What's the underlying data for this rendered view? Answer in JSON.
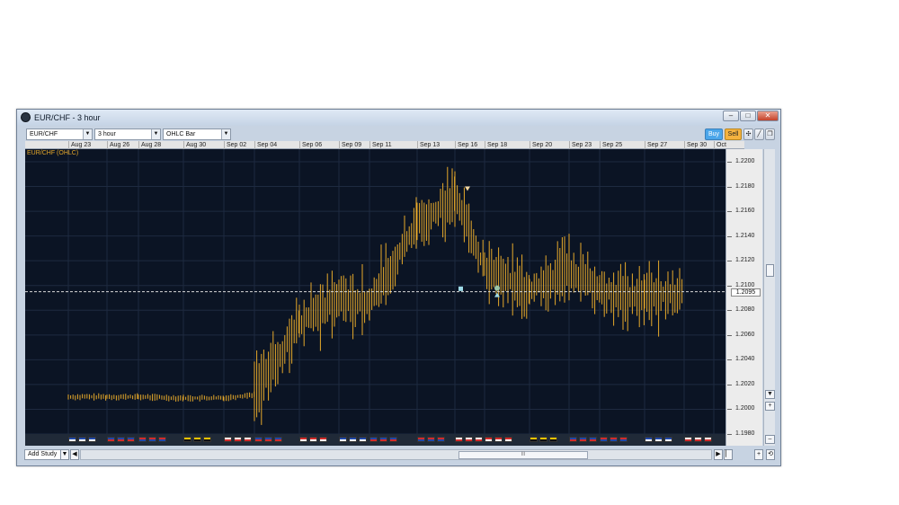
{
  "window": {
    "title": "EUR/CHF - 3 hour",
    "controls": {
      "minimize": "–",
      "maximize": "□",
      "close": "✕"
    }
  },
  "toolbar": {
    "symbol": "EUR/CHF",
    "interval": "3 hour",
    "chart_type": "OHLC Bar",
    "buy_label": "Buy",
    "sell_label": "Sell",
    "icons": [
      "crosshair-icon",
      "draw-line-icon",
      "popout-icon"
    ]
  },
  "chart": {
    "series_label": "EUR/CHF (OHLC)",
    "current_price": "1.2095",
    "dates": [
      "Aug 23",
      "Aug 26",
      "Aug 28",
      "Aug 30",
      "Sep 02",
      "Sep 04",
      "Sep 06",
      "Sep 09",
      "Sep 11",
      "Sep 13",
      "Sep 16",
      "Sep 18",
      "Sep 20",
      "Sep 23",
      "Sep 25",
      "Sep 27",
      "Sep 30",
      "Oct"
    ],
    "price_ticks": [
      "1.2200",
      "1.2180",
      "1.2160",
      "1.2140",
      "1.2120",
      "1.2100",
      "1.2080",
      "1.2060",
      "1.2040",
      "1.2020",
      "1.2000",
      "1.1980"
    ]
  },
  "chart_data": {
    "type": "ohlc",
    "series_name": "EUR/CHF (OHLC)",
    "ylim": [
      1.198,
      1.22
    ],
    "grid": true,
    "current_price": 1.2095,
    "x_tick_labels": [
      "Aug 23",
      "Aug 26",
      "Aug 28",
      "Aug 30",
      "Sep 02",
      "Sep 04",
      "Sep 06",
      "Sep 09",
      "Sep 11",
      "Sep 13",
      "Sep 16",
      "Sep 18",
      "Sep 20",
      "Sep 23",
      "Sep 25",
      "Sep 27",
      "Sep 30",
      "Oct"
    ],
    "closes_by_date": [
      {
        "date": "Aug 23",
        "close": 1.201
      },
      {
        "date": "Aug 26",
        "close": 1.201
      },
      {
        "date": "Aug 28",
        "close": 1.201
      },
      {
        "date": "Aug 30",
        "close": 1.2009
      },
      {
        "date": "Sep 02",
        "close": 1.2009
      },
      {
        "date": "Sep 04",
        "close": 1.2012
      },
      {
        "date": "Sep 06",
        "close": 1.207
      },
      {
        "date": "Sep 09",
        "close": 1.209
      },
      {
        "date": "Sep 11",
        "close": 1.2085
      },
      {
        "date": "Sep 13",
        "close": 1.215
      },
      {
        "date": "Sep 16",
        "close": 1.217
      },
      {
        "date": "Sep 18",
        "close": 1.2115
      },
      {
        "date": "Sep 20",
        "close": 1.2095
      },
      {
        "date": "Sep 23",
        "close": 1.2115
      },
      {
        "date": "Sep 25",
        "close": 1.2095
      },
      {
        "date": "Sep 27",
        "close": 1.209
      },
      {
        "date": "Sep 30",
        "close": 1.2095
      }
    ],
    "markers": [
      {
        "type": "sell-arrow",
        "date": "Sep 16",
        "price": 1.218
      },
      {
        "type": "buy-arrow",
        "date": "Sep 18",
        "price": 1.2095
      },
      {
        "type": "square",
        "date": "Sep 16",
        "price": 1.2097
      }
    ]
  },
  "flags": [
    {
      "date": "Aug 23",
      "colors": [
        "#1f47a8",
        "#ffffff"
      ]
    },
    {
      "date": "Aug 26",
      "colors": [
        "#1f47a8",
        "#d12b2b"
      ]
    },
    {
      "date": "Aug 28",
      "colors": [
        "#d12b2b",
        "#1f47a8"
      ]
    },
    {
      "date": "Aug 30",
      "colors": [
        "#f0c400",
        "#111111"
      ]
    },
    {
      "date": "Sep 02",
      "colors": [
        "#ffffff",
        "#d12b2b"
      ]
    },
    {
      "date": "Sep 04",
      "colors": [
        "#1f47a8",
        "#d12b2b"
      ]
    },
    {
      "date": "Sep 06",
      "colors": [
        "#d12b2b",
        "#ffffff"
      ]
    },
    {
      "date": "Sep 09",
      "colors": [
        "#1f47a8",
        "#ffffff"
      ]
    },
    {
      "date": "Sep 11",
      "colors": [
        "#1f47a8",
        "#d12b2b"
      ]
    },
    {
      "date": "Sep 13",
      "colors": [
        "#d12b2b",
        "#1f47a8"
      ]
    },
    {
      "date": "Sep 16",
      "colors": [
        "#ffffff",
        "#d12b2b"
      ]
    },
    {
      "date": "Sep 18",
      "colors": [
        "#d12b2b",
        "#ffffff"
      ]
    },
    {
      "date": "Sep 20",
      "colors": [
        "#f0c400",
        "#111111"
      ]
    },
    {
      "date": "Sep 23",
      "colors": [
        "#1f47a8",
        "#d12b2b"
      ]
    },
    {
      "date": "Sep 25",
      "colors": [
        "#d12b2b",
        "#1f47a8"
      ]
    },
    {
      "date": "Sep 27",
      "colors": [
        "#1f47a8",
        "#ffffff"
      ]
    },
    {
      "date": "Sep 30",
      "colors": [
        "#ffffff",
        "#d12b2b"
      ]
    }
  ],
  "bottom": {
    "add_study_label": "Add Study",
    "scroll_grip": "III",
    "arrows": {
      "left": "◀",
      "right": "▶",
      "plus": "+",
      "minus": "–",
      "up": "▲",
      "down": "▼",
      "reset": "⟲"
    }
  },
  "colors": {
    "chart_bg": "#0b1424",
    "grid": "#1e2a40",
    "bar": "#e7a92a",
    "price_line": "#d9d9d9",
    "buy": "#4ba6ea",
    "sell": "#f4b23f"
  }
}
